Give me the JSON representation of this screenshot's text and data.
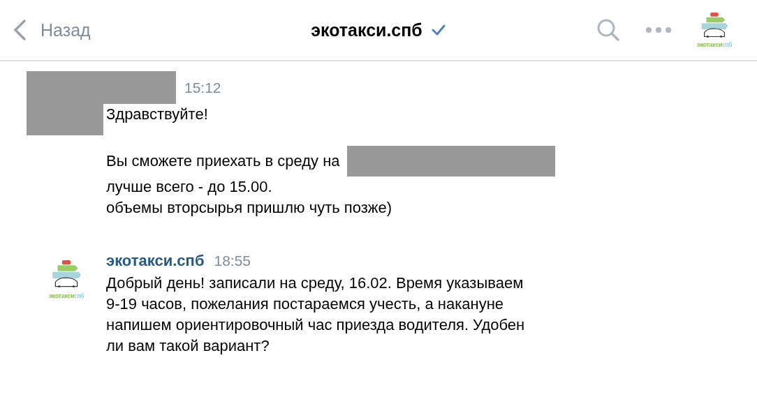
{
  "header": {
    "back_label": "Назад",
    "title": "экотакси.спб",
    "verified": true,
    "logo_text": [
      "экотакси",
      "спб"
    ]
  },
  "messages": [
    {
      "kind": "redacted",
      "time": "15:12",
      "paragraphs": [
        [
          {
            "kind": "plain",
            "text": "Здравствуйте!"
          }
        ],
        [
          {
            "kind": "redacted_tail",
            "text": "Вы сможете приехать в среду на"
          },
          {
            "kind": "plain",
            "text": "лучше всего - до 15.00."
          },
          {
            "kind": "plain",
            "text": "объемы вторсырья пришлю чуть позже)"
          }
        ]
      ]
    },
    {
      "kind": "author",
      "author": "экотакси.спб",
      "time": "18:55",
      "logo_text": [
        "экотакси",
        "спб"
      ],
      "paragraphs": [
        [
          {
            "kind": "plain",
            "text": "Добрый день! записали на среду, 16.02. Время указываем"
          },
          {
            "kind": "plain",
            "text": "9-19 часов, пожелания постараемся учесть, а накануне"
          },
          {
            "kind": "plain",
            "text": "напишем ориентировочный час приезда водителя. Удобен"
          },
          {
            "kind": "plain",
            "text": "ли вам такой вариант?"
          }
        ]
      ]
    }
  ]
}
